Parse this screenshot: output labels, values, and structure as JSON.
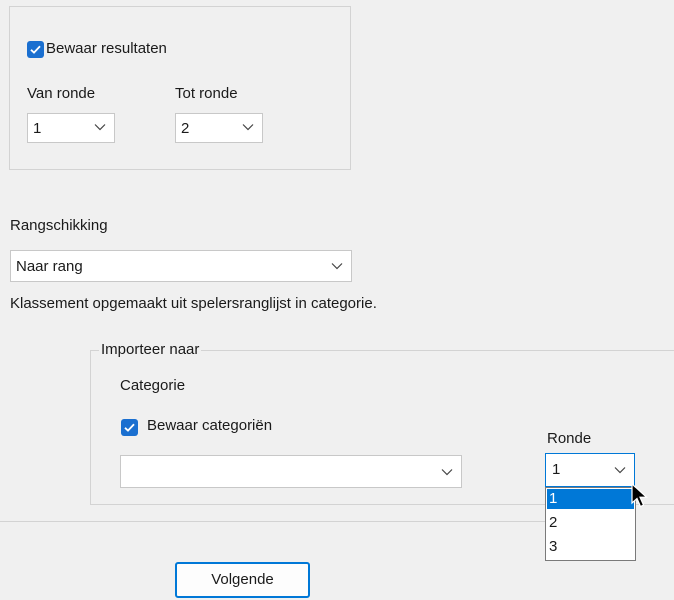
{
  "save_results": {
    "label": "Bewaar resultaten",
    "checked": true
  },
  "from_round": {
    "label": "Van ronde",
    "value": "1"
  },
  "to_round": {
    "label": "Tot ronde",
    "value": "2"
  },
  "ranking": {
    "label": "Rangschikking",
    "value": "Naar rang",
    "description": "Klassement opgemaakt uit spelersranglijst in categorie."
  },
  "import_group": {
    "title": "Importeer naar",
    "category_label": "Categorie",
    "save_categories": {
      "label": "Bewaar categoriën",
      "checked": true
    },
    "category_value": "",
    "round_label": "Ronde",
    "round_value": "1",
    "round_options": [
      "1",
      "2",
      "3"
    ],
    "round_selected": "1"
  },
  "next_button": {
    "label": "Volgende"
  },
  "colors": {
    "accent": "#0078d7",
    "checkbox": "#1a6fd0"
  }
}
